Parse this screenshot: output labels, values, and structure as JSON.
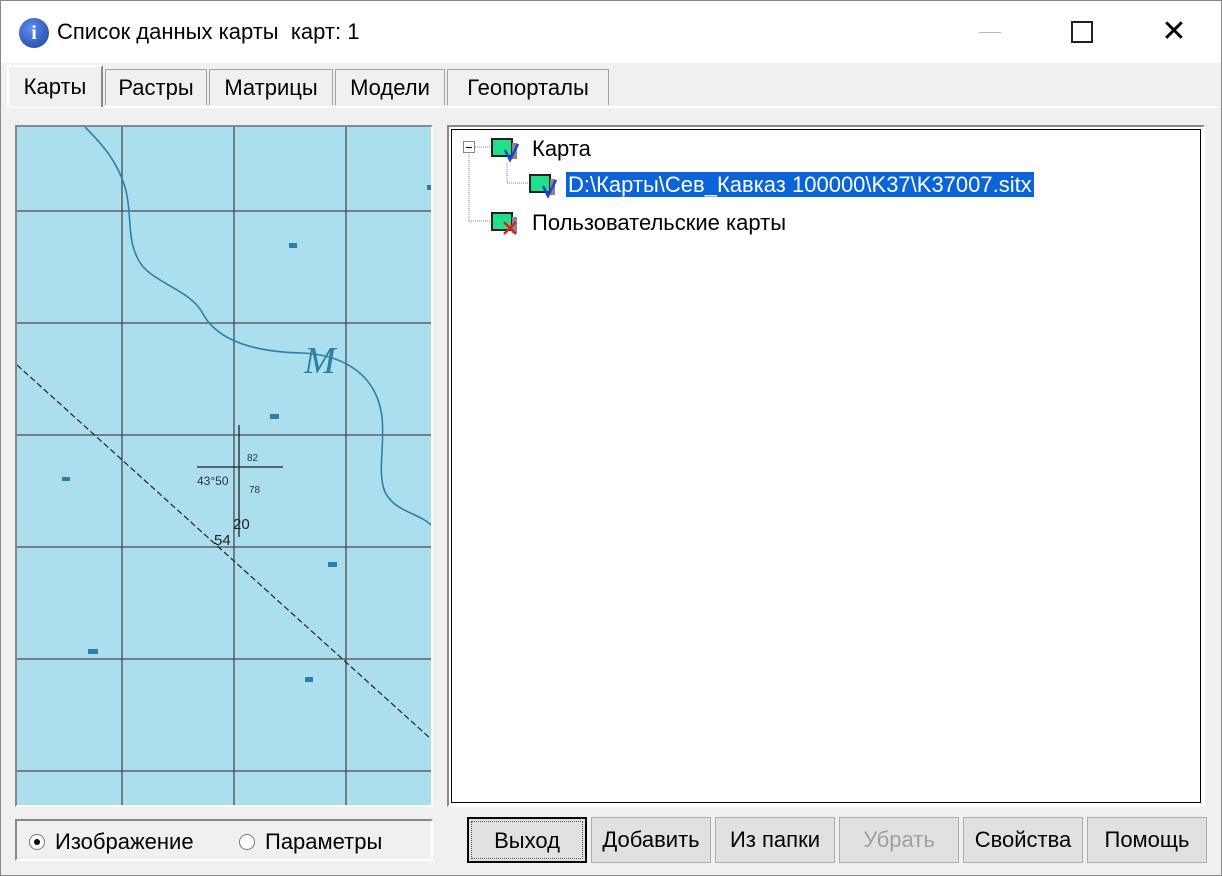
{
  "window": {
    "title": "Список данных карты  карт: 1"
  },
  "tabs": [
    {
      "label": "Карты",
      "active": true
    },
    {
      "label": "Растры",
      "active": false
    },
    {
      "label": "Матрицы",
      "active": false
    },
    {
      "label": "Модели",
      "active": false
    },
    {
      "label": "Геопорталы",
      "active": false
    }
  ],
  "tree": {
    "root": {
      "label": "Карта",
      "icon": "map-layer-check-icon"
    },
    "child": {
      "label": "D:\\Карты\\Сев_Кавказ 100000\\K37\\K37007.sitx",
      "selected": true,
      "icon": "map-layer-check-icon"
    },
    "user_maps": {
      "label": "Пользовательские карты",
      "icon": "map-layer-cross-icon"
    }
  },
  "preview": {
    "marker_letter": "M",
    "coord_label": "43°50",
    "num_20": "20",
    "num_54": "54",
    "small_a": "82",
    "small_b": "78"
  },
  "view_mode": {
    "image_label": "Изображение",
    "params_label": "Параметры",
    "selected": "image"
  },
  "buttons": {
    "exit": "Выход",
    "add": "Добавить",
    "from_folder": "Из папки",
    "remove": "Убрать",
    "properties": "Свойства",
    "help": "Помощь"
  },
  "colors": {
    "map_bg": "#acdfee",
    "grid": "#4a4a4a",
    "river": "#2d7fa8",
    "selection": "#0a64d8"
  }
}
